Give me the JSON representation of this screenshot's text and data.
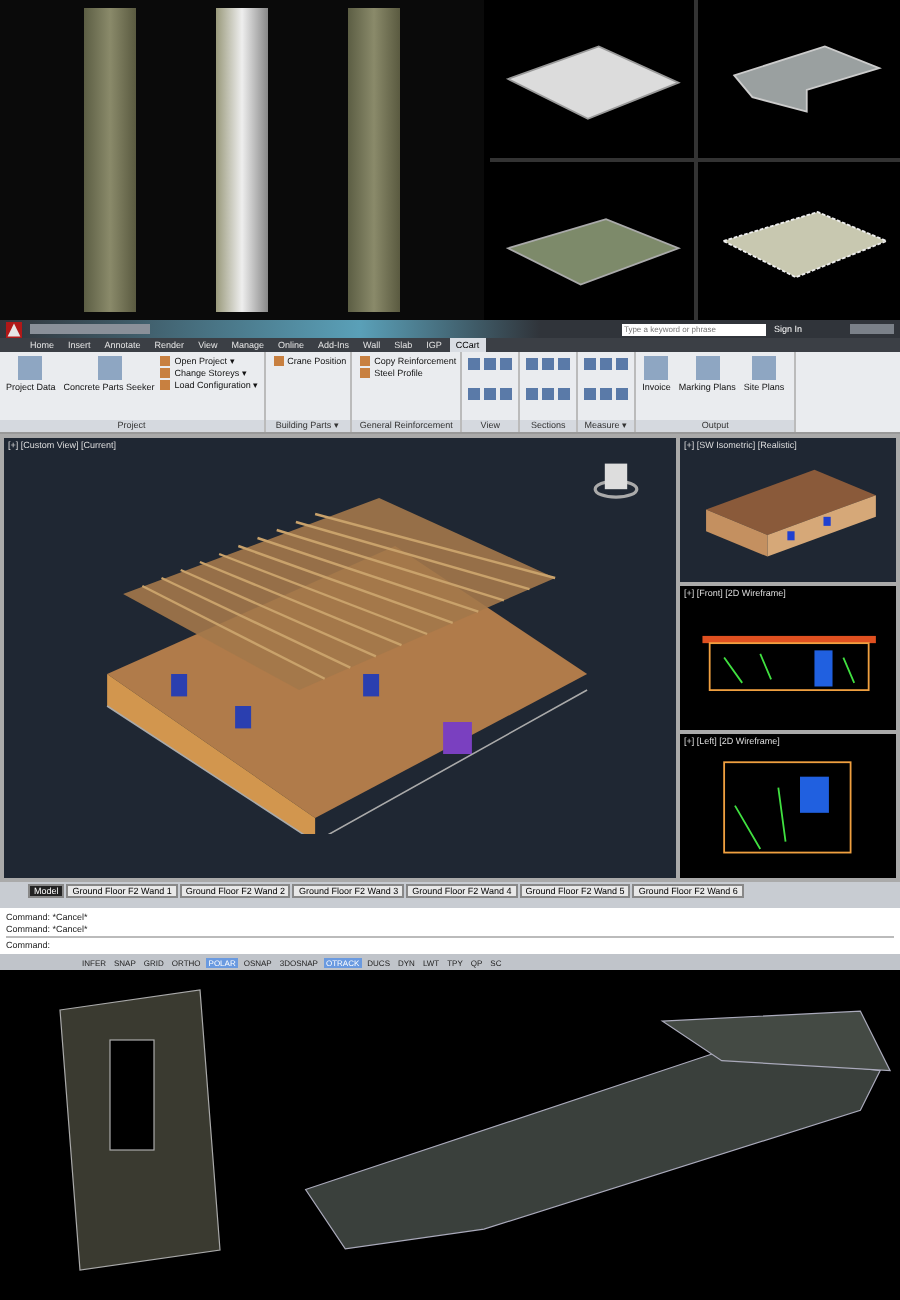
{
  "window": {
    "search": {
      "placeholder": "Type a keyword or phrase"
    },
    "sign_in": "Sign In"
  },
  "ribbon_tabs": [
    {
      "label": "Home",
      "selected": false
    },
    {
      "label": "Insert",
      "selected": false
    },
    {
      "label": "Annotate",
      "selected": false
    },
    {
      "label": "Render",
      "selected": false
    },
    {
      "label": "View",
      "selected": false
    },
    {
      "label": "Manage",
      "selected": false
    },
    {
      "label": "Online",
      "selected": false
    },
    {
      "label": "Add-Ins",
      "selected": false
    },
    {
      "label": "Wall",
      "selected": false
    },
    {
      "label": "Slab",
      "selected": false
    },
    {
      "label": "IGP",
      "selected": false
    },
    {
      "label": "CCart",
      "selected": true
    }
  ],
  "ribbon_panels": [
    {
      "title": "Project",
      "kind": "tools",
      "buttons": [
        {
          "label": "Project Data",
          "kind": "large"
        },
        {
          "label": "Concrete Parts Seeker",
          "kind": "large"
        },
        {
          "label": "Open Project ▾",
          "kind": "small"
        },
        {
          "label": "Change Storeys ▾",
          "kind": "small"
        },
        {
          "label": "Load Configuration ▾",
          "kind": "small"
        }
      ]
    },
    {
      "title": "Building Parts ▾",
      "kind": "tools",
      "buttons": [
        {
          "label": "Crane Position",
          "kind": "small"
        }
      ]
    },
    {
      "title": "General Reinforcement",
      "kind": "tools",
      "buttons": [
        {
          "label": "Copy Reinforcement",
          "kind": "small"
        },
        {
          "label": "Steel Profile",
          "kind": "small"
        }
      ]
    },
    {
      "title": "View",
      "kind": "icons"
    },
    {
      "title": "Sections",
      "kind": "icons"
    },
    {
      "title": "Measure ▾",
      "kind": "icons"
    },
    {
      "title": "Output",
      "kind": "tools",
      "buttons": [
        {
          "label": "Invoice",
          "kind": "large"
        },
        {
          "label": "Marking Plans",
          "kind": "large"
        },
        {
          "label": "Site Plans",
          "kind": "large"
        }
      ]
    }
  ],
  "viewports": [
    {
      "label": "[+] [Custom View] [Current]",
      "kind": "main"
    },
    {
      "label": "[+] [SW Isometric] [Realistic]",
      "kind": "iso"
    },
    {
      "label": "[+] [Front] [2D Wireframe]",
      "kind": "front"
    },
    {
      "label": "[+] [Left] [2D Wireframe]",
      "kind": "left"
    }
  ],
  "layout_tabs": [
    {
      "label": "Model",
      "selected": true
    },
    {
      "label": "Ground Floor F2 Wand 1",
      "selected": false
    },
    {
      "label": "Ground Floor F2 Wand 2",
      "selected": false
    },
    {
      "label": "Ground Floor F2 Wand 3",
      "selected": false
    },
    {
      "label": "Ground Floor F2 Wand 4",
      "selected": false
    },
    {
      "label": "Ground Floor F2 Wand 5",
      "selected": false
    },
    {
      "label": "Ground Floor F2 Wand 6",
      "selected": false
    }
  ],
  "command_history": [
    "Command:  *Cancel*",
    "Command:  *Cancel*"
  ],
  "command_prompt": "Command:",
  "status_toggles": [
    {
      "label": "INFER",
      "on": false
    },
    {
      "label": "SNAP",
      "on": false
    },
    {
      "label": "GRID",
      "on": false
    },
    {
      "label": "ORTHO",
      "on": false
    },
    {
      "label": "POLAR",
      "on": true
    },
    {
      "label": "OSNAP",
      "on": false
    },
    {
      "label": "3DOSNAP",
      "on": false
    },
    {
      "label": "OTRACK",
      "on": true
    },
    {
      "label": "DUCS",
      "on": false
    },
    {
      "label": "DYN",
      "on": false
    },
    {
      "label": "LWT",
      "on": false
    },
    {
      "label": "TPY",
      "on": false
    },
    {
      "label": "QP",
      "on": false
    },
    {
      "label": "SC",
      "on": false
    }
  ]
}
